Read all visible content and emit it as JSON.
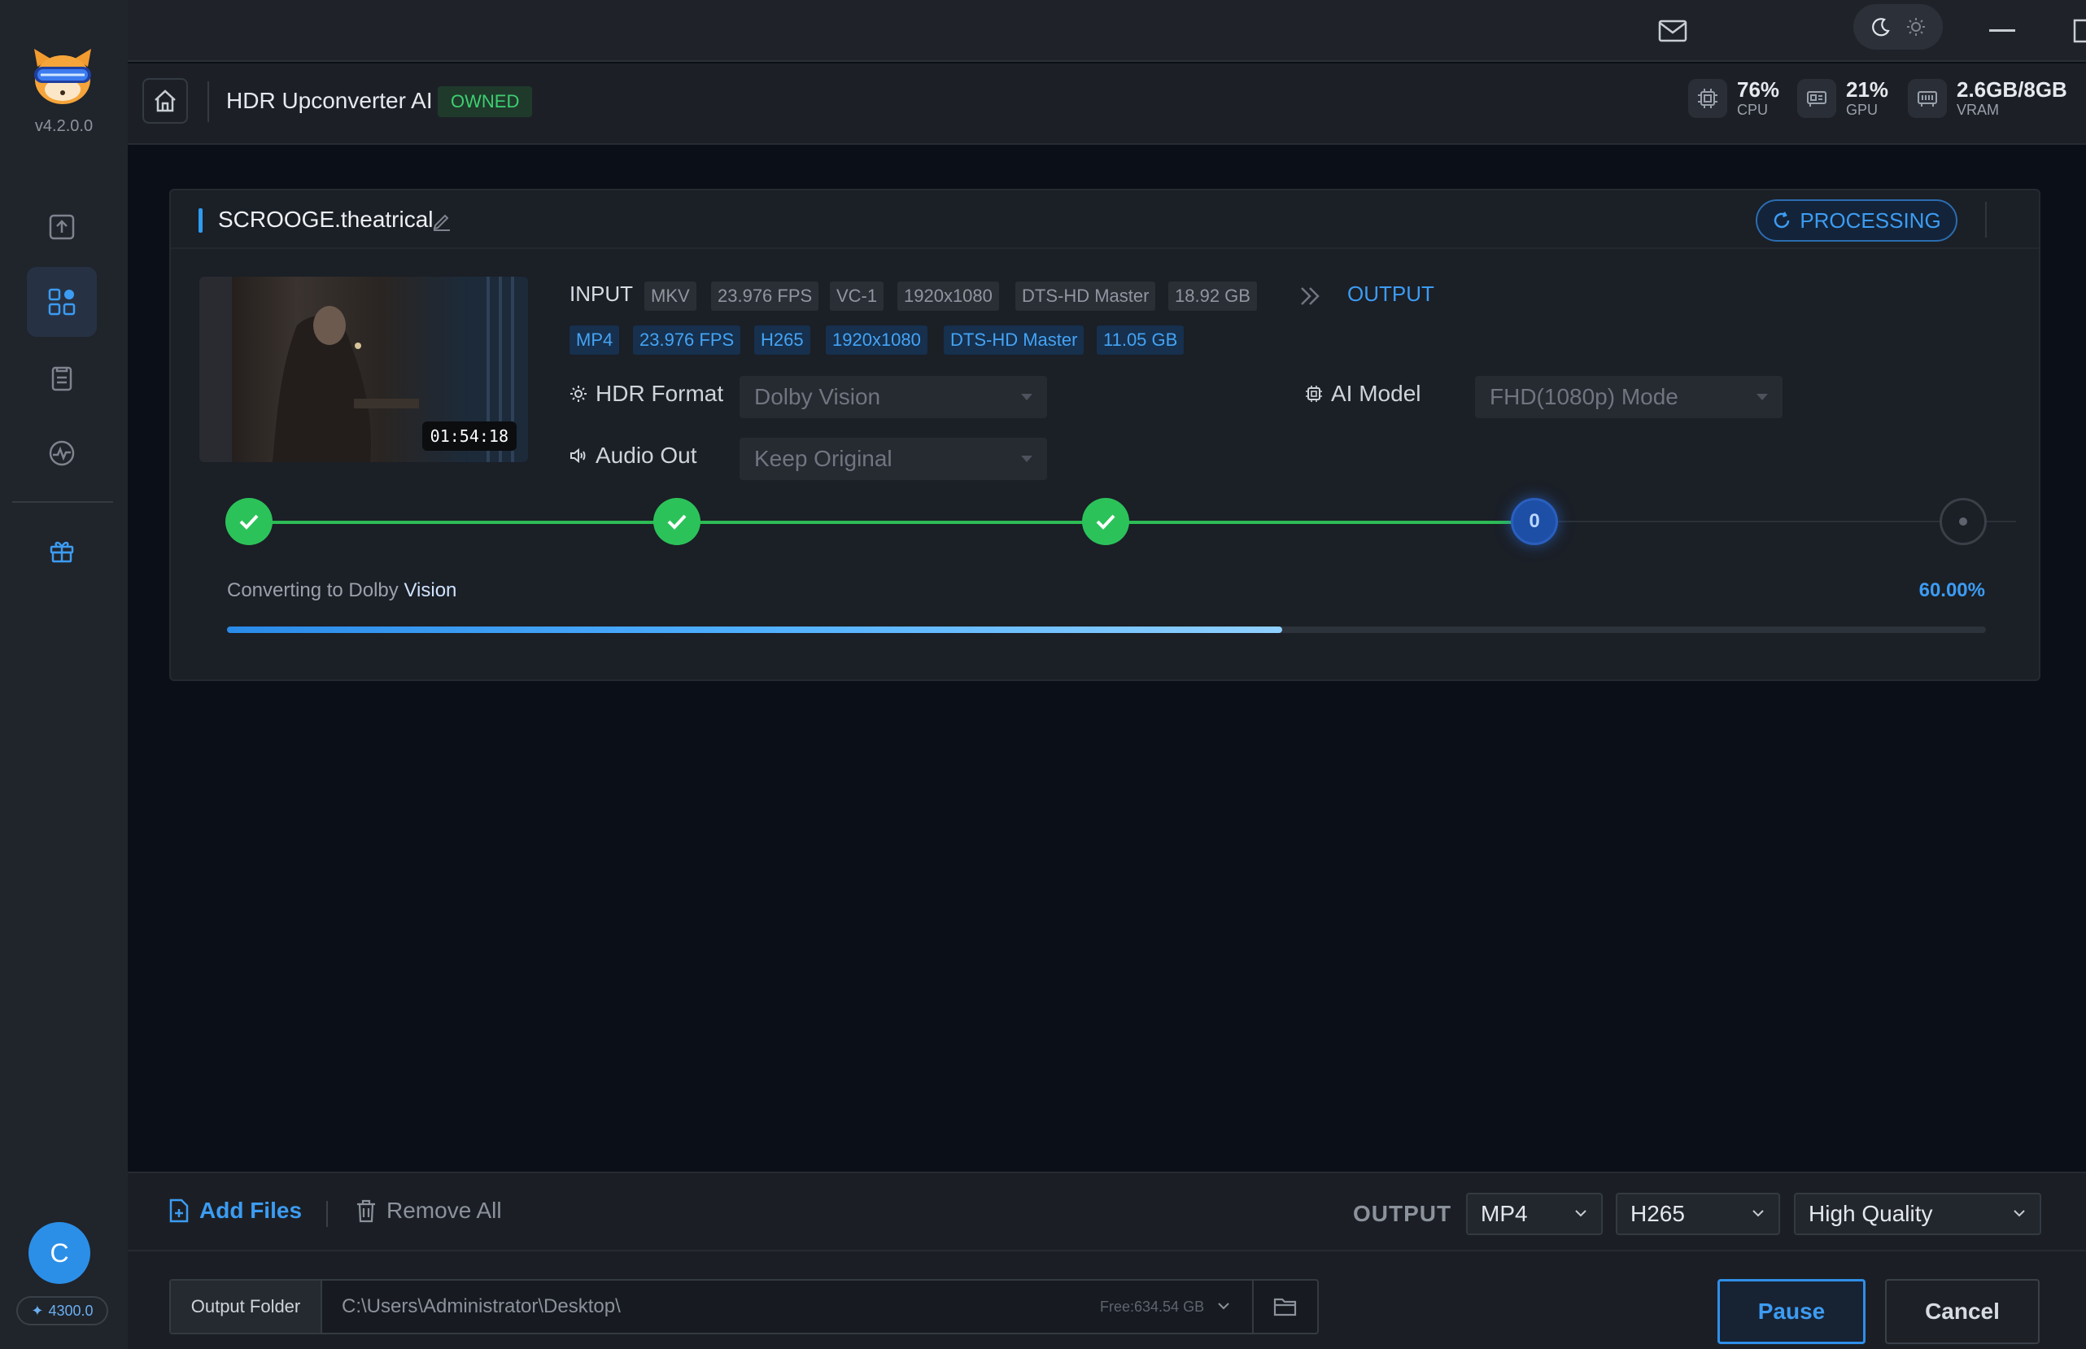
{
  "app": {
    "version": "v4.2.0.0",
    "title": "HDR Upconverter AI",
    "license_badge": "OWNED"
  },
  "sidebar": {
    "items": [
      {
        "name": "upload",
        "icon": "upload-icon",
        "active": false
      },
      {
        "name": "dashboard",
        "icon": "grid-icon",
        "active": true
      },
      {
        "name": "tasks",
        "icon": "clipboard-icon",
        "active": false
      },
      {
        "name": "monitor",
        "icon": "activity-icon",
        "active": false
      },
      {
        "name": "gift",
        "icon": "gift-icon",
        "active": false
      }
    ],
    "user_initial": "C",
    "credits": "4300.0"
  },
  "stats": {
    "cpu": {
      "value": "76%",
      "label": "CPU"
    },
    "gpu": {
      "value": "21%",
      "label": "GPU"
    },
    "vram": {
      "value": "2.6GB/8GB",
      "label": "VRAM"
    }
  },
  "task": {
    "file_name": "SCROOGE.theatrical",
    "status": "PROCESSING",
    "duration": "01:54:18",
    "input_label": "INPUT",
    "input_chips": [
      "MKV",
      "23.976 FPS",
      "VC-1",
      "1920x1080",
      "DTS-HD Master",
      "18.92 GB"
    ],
    "output_label": "OUTPUT",
    "output_chips": [
      "MP4",
      "23.976 FPS",
      "H265",
      "1920x1080",
      "DTS-HD Master",
      "11.05 GB"
    ],
    "hdr_format_label": "HDR Format",
    "hdr_format_value": "Dolby Vision",
    "ai_model_label": "AI Model",
    "ai_model_value": "FHD(1080p) Mode",
    "audio_out_label": "Audio Out",
    "audio_out_value": "Keep Original",
    "current_step_number": "0",
    "progress_text_prefix": "Converting to Dolby ",
    "progress_text_suffix": "Vision",
    "progress_percent": "60.00%",
    "progress_fraction": 0.6
  },
  "footer": {
    "add_files": "Add Files",
    "remove_all": "Remove All",
    "output_label": "OUTPUT",
    "format": "MP4",
    "codec": "H265",
    "quality": "High Quality",
    "output_folder_label": "Output Folder",
    "output_path": "C:\\Users\\Administrator\\Desktop\\",
    "free_space": "Free:634.54 GB",
    "pause": "Pause",
    "cancel": "Cancel"
  },
  "colors": {
    "accent": "#3c9cf3",
    "success": "#2cc25a",
    "owned": "#3ecf72"
  }
}
